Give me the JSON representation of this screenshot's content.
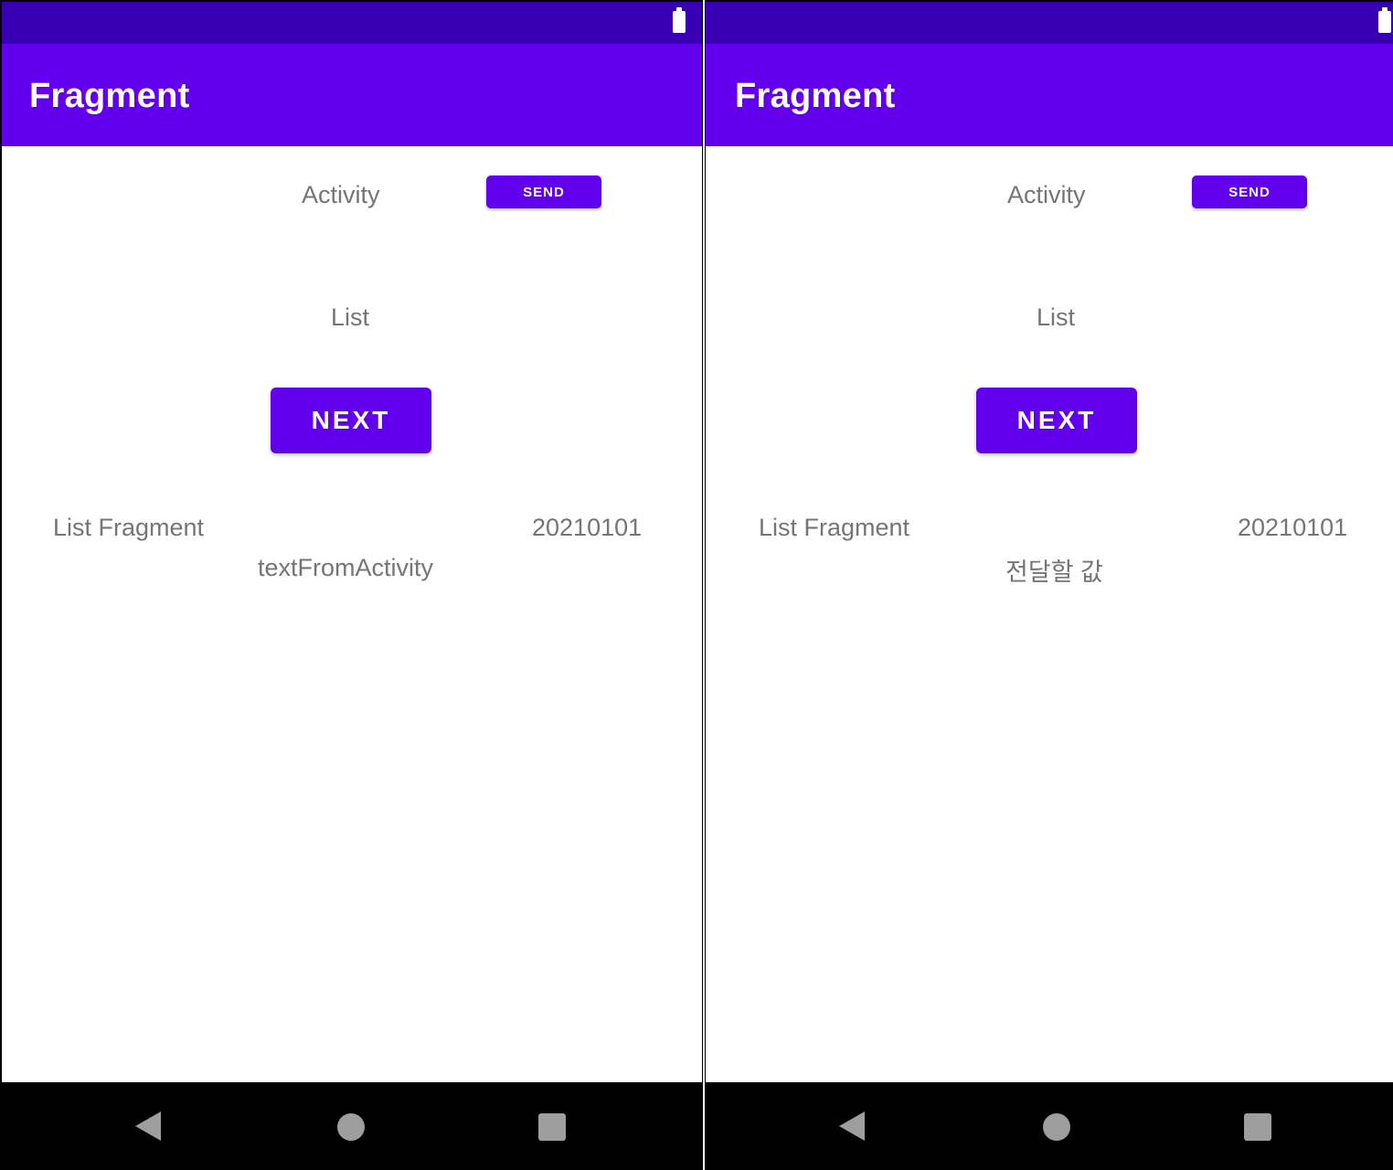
{
  "screens": [
    {
      "app_bar": {
        "title": "Fragment"
      },
      "activity": {
        "label": "Activity",
        "send_label": "SEND"
      },
      "list_title": "List",
      "next_label": "NEXT",
      "fragment": {
        "title": "List Fragment",
        "date": "20210101",
        "received_text": "textFromActivity"
      }
    },
    {
      "app_bar": {
        "title": "Fragment"
      },
      "activity": {
        "label": "Activity",
        "send_label": "SEND"
      },
      "list_title": "List",
      "next_label": "NEXT",
      "fragment": {
        "title": "List Fragment",
        "date": "20210101",
        "received_text": "전달할 값"
      }
    }
  ],
  "icons": {
    "status": "battery-icon",
    "nav": [
      "back-icon",
      "home-icon",
      "recents-icon"
    ]
  },
  "colors": {
    "status_bar": "#3700b3",
    "primary": "#6200ee",
    "text_secondary": "#757575"
  }
}
